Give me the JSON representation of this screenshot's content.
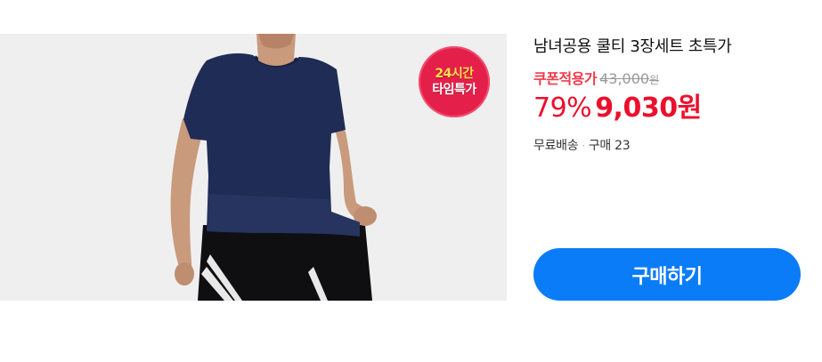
{
  "product": {
    "title": "남녀공용 쿨티 3장세트 초특가",
    "image_alt": "navy t-shirt model photo",
    "badge": {
      "line1": "24시간",
      "line2": "타임특가",
      "color": "#e4204a"
    }
  },
  "pricing": {
    "coupon_label": "쿠폰적용가",
    "original_price": "43,000",
    "original_unit": "원",
    "discount_rate": "79%",
    "sale_price": "9,030",
    "sale_unit": "원",
    "price_color": "#ec0f2d"
  },
  "shipping": {
    "free_shipping": "무료배송",
    "separator": "·",
    "purchase_count": "구매 23"
  },
  "actions": {
    "buy_label": "구매하기",
    "buy_color": "#0b7cf7"
  }
}
